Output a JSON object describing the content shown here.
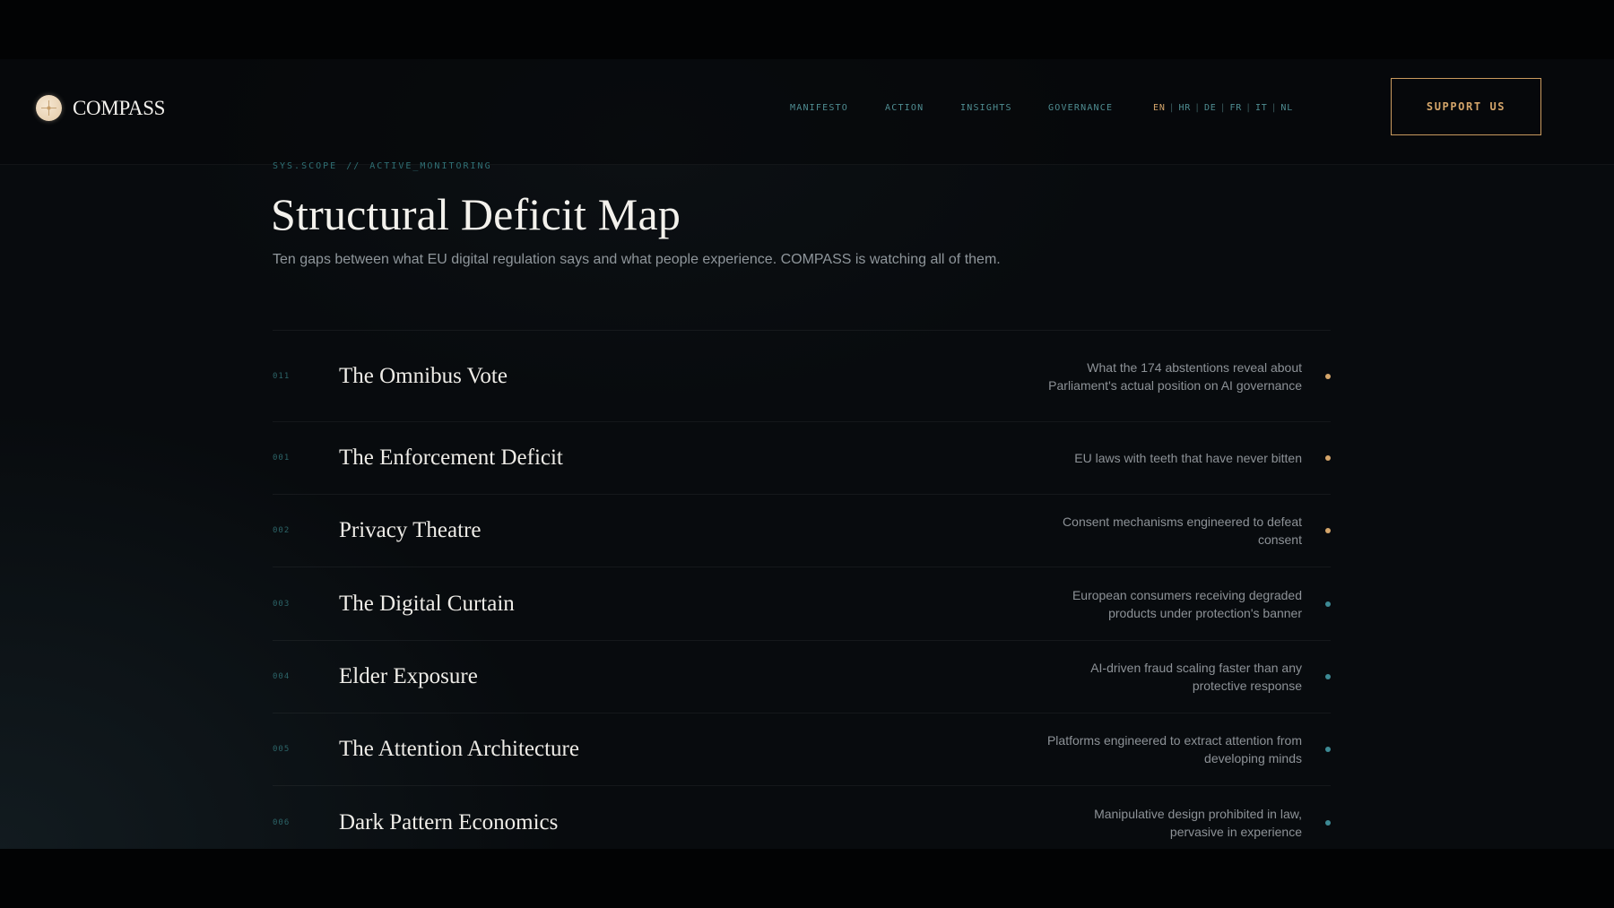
{
  "brand": {
    "name": "COMPASS"
  },
  "nav": {
    "items": [
      {
        "label": "MANIFESTO"
      },
      {
        "label": "ACTION"
      },
      {
        "label": "INSIGHTS"
      },
      {
        "label": "GOVERNANCE"
      }
    ],
    "languages": [
      "EN",
      "HR",
      "DE",
      "FR",
      "IT",
      "NL"
    ],
    "active_language": "EN",
    "support_label": "SUPPORT US"
  },
  "intro": {
    "eyebrow_left": "SYS.SCOPE",
    "eyebrow_sep": "//",
    "eyebrow_right": "ACTIVE_MONITORING",
    "title": "Structural Deficit Map",
    "subtitle": "Ten gaps between what EU digital regulation says and what people experience. COMPASS is watching all of them."
  },
  "colors": {
    "accent_gold": "#d4a56a",
    "accent_teal": "#3d8a94"
  },
  "deficits": [
    {
      "num": "011",
      "title": "The Omnibus Vote",
      "desc": "What the 174 abstentions reveal about Parliament's actual position on AI governance",
      "status": "gold"
    },
    {
      "num": "001",
      "title": "The Enforcement Deficit",
      "desc": "EU laws with teeth that have never bitten",
      "status": "gold"
    },
    {
      "num": "002",
      "title": "Privacy Theatre",
      "desc": "Consent mechanisms engineered to defeat consent",
      "status": "gold"
    },
    {
      "num": "003",
      "title": "The Digital Curtain",
      "desc": "European consumers receiving degraded products under protection's banner",
      "status": "teal"
    },
    {
      "num": "004",
      "title": "Elder Exposure",
      "desc": "AI-driven fraud scaling faster than any protective response",
      "status": "teal"
    },
    {
      "num": "005",
      "title": "The Attention Architecture",
      "desc": "Platforms engineered to extract attention from developing minds",
      "status": "teal"
    },
    {
      "num": "006",
      "title": "Dark Pattern Economics",
      "desc": "Manipulative design prohibited in law, pervasive in experience",
      "status": "teal"
    }
  ]
}
